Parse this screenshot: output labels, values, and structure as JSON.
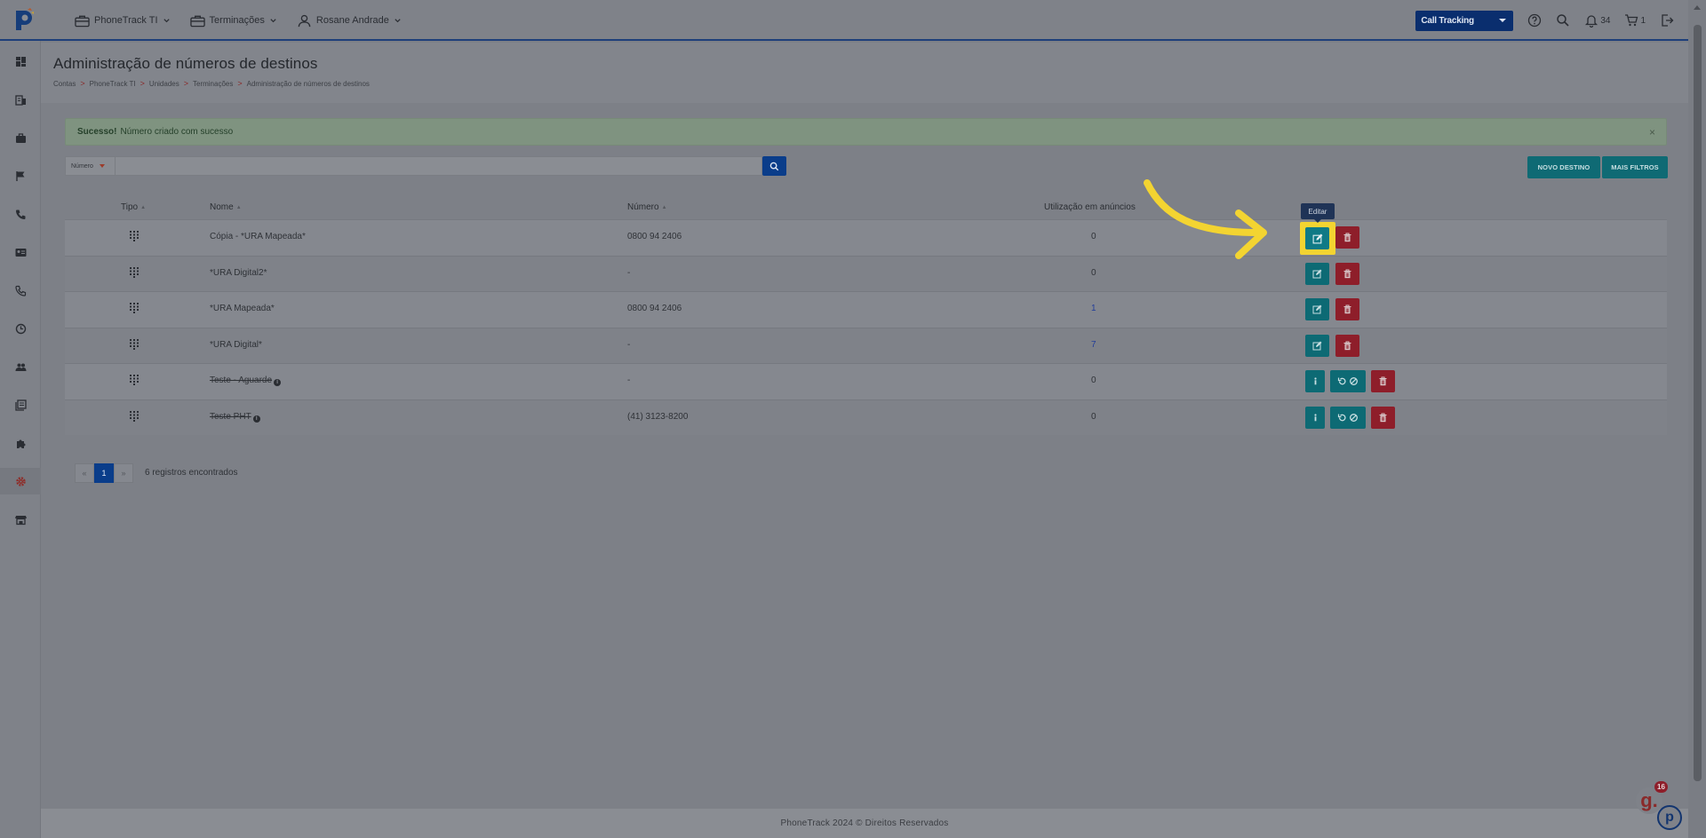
{
  "topnav": [
    {
      "label": "PhoneTrack TI",
      "icon": "briefcase-icon"
    },
    {
      "label": "Terminações",
      "icon": "briefcase-icon"
    },
    {
      "label": "Rosane Andrade",
      "icon": "user-icon"
    }
  ],
  "topright": {
    "product_select": "Call Tracking",
    "notifications_count": "34",
    "cart_count": "1"
  },
  "sidebar_icons": [
    "dashboard-icon",
    "building-icon",
    "briefcase-icon",
    "flag-icon",
    "phone-icon",
    "contact-card-icon",
    "phone-call-icon",
    "clock-icon",
    "users-icon",
    "library-icon",
    "puzzle-icon",
    "settings-icon",
    "store-icon"
  ],
  "page": {
    "title": "Administração de números de destinos",
    "breadcrumb": [
      "Contas",
      "PhoneTrack TI",
      "Unidades",
      "Terminações",
      "Administração de números de destinos"
    ]
  },
  "alert": {
    "strong": "Sucesso!",
    "text": "Número criado com sucesso",
    "close": "×"
  },
  "search": {
    "select_value": "Número",
    "placeholder": ""
  },
  "buttons": {
    "new_destination": "NOVO DESTINO",
    "more_filters": "MAIS FILTROS"
  },
  "table": {
    "headers": {
      "tipo": "Tipo",
      "nome": "Nome",
      "numero": "Número",
      "utilizacao": "Utilização em anúncios"
    },
    "rows": [
      {
        "name": "Cópia - *URA Mapeada*",
        "number": "0800 94 2406",
        "usage": "0",
        "deleted": false
      },
      {
        "name": "*URA Digital2*",
        "number": "-",
        "usage": "0",
        "deleted": false
      },
      {
        "name": "*URA Mapeada*",
        "number": "0800 94 2406",
        "usage": "1",
        "deleted": false
      },
      {
        "name": "*URA Digital*",
        "number": "-",
        "usage": "7",
        "deleted": false
      },
      {
        "name": "Teste - Aguarde",
        "number": "-",
        "usage": "0",
        "deleted": true
      },
      {
        "name": "Teste PHT",
        "number": "(41) 3123-8200",
        "usage": "0",
        "deleted": true
      }
    ]
  },
  "tooltip": "Editar",
  "pagination": {
    "prev": "«",
    "current": "1",
    "next": "»",
    "summary": "6 registros encontrados"
  },
  "footer": "PhoneTrack 2024 © Direitos Reservados",
  "widgets": {
    "g_letter": "g.",
    "g_badge": "16",
    "p_letter": "p"
  },
  "colors": {
    "primary": "#0a3d8a",
    "teal": "#0d6a74",
    "danger": "#8e1e2a",
    "highlight": "#f3d431"
  }
}
